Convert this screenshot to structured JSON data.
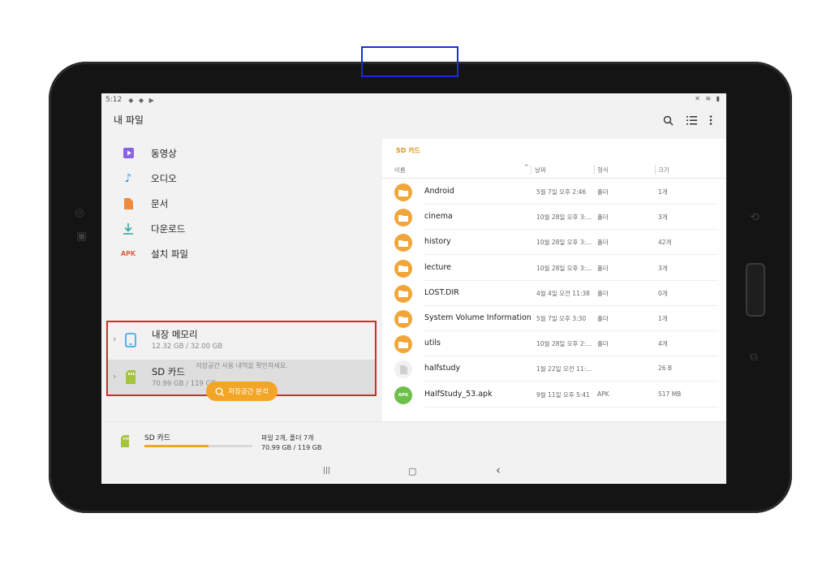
{
  "statusbar": {
    "time": "5:12",
    "left_icons": "◆ ◆ ▶",
    "right_icons": "✕ ≋ ▮"
  },
  "app": {
    "title": "내 파일"
  },
  "toolbar": {
    "search_icon": "search-icon",
    "list_icon": "list-view-icon",
    "more_icon": "more-vert-icon"
  },
  "categories": [
    {
      "label": "동영상",
      "icon": "video-icon",
      "color": "#8b63e0"
    },
    {
      "label": "오디오",
      "icon": "music-icon",
      "color": "#2e9ae6"
    },
    {
      "label": "문서",
      "icon": "document-icon",
      "color": "#f08a3c"
    },
    {
      "label": "다운로드",
      "icon": "download-icon",
      "color": "#38a7a0"
    },
    {
      "label": "설치 파일",
      "icon": "apk-icon",
      "text": "APK",
      "color": "#e25c3f"
    }
  ],
  "storage": [
    {
      "name": "내장 메모리",
      "size": "12.32 GB / 32.00 GB"
    },
    {
      "name": "SD 카드",
      "size": "70.99 GB / 119 GB"
    }
  ],
  "storage_hint": "저장공간 사용 내역을 확인하세요.",
  "analyze_button": "저장공간 분석",
  "path": "SD 카드",
  "columns": {
    "name": "이름",
    "date": "날짜",
    "type": "형식",
    "size": "크기"
  },
  "files": [
    {
      "name": "Android",
      "date": "5월 7일 오후 2:46",
      "type": "폴더",
      "size": "1개",
      "kind": "folder"
    },
    {
      "name": "cinema",
      "date": "10월 28일 오후 3:...",
      "type": "폴더",
      "size": "3개",
      "kind": "folder"
    },
    {
      "name": "history",
      "date": "10월 28일 오후 3:...",
      "type": "폴더",
      "size": "42개",
      "kind": "folder"
    },
    {
      "name": "lecture",
      "date": "10월 28일 오후 3:...",
      "type": "폴더",
      "size": "3개",
      "kind": "folder"
    },
    {
      "name": "LOST.DIR",
      "date": "4월 4일 오전 11:38",
      "type": "폴더",
      "size": "0개",
      "kind": "folder"
    },
    {
      "name": "System Volume Information",
      "date": "5월 7일 오후 3:30",
      "type": "폴더",
      "size": "1개",
      "kind": "folder"
    },
    {
      "name": "utils",
      "date": "10월 28일 오후 2:...",
      "type": "폴더",
      "size": "4개",
      "kind": "folder"
    },
    {
      "name": "halfstudy",
      "date": "1월 22일 오전 11:...",
      "type": "",
      "size": "26 B",
      "kind": "file"
    },
    {
      "name": "HalfStudy_53.apk",
      "date": "9월 11일 오후 5:41",
      "type": "APK",
      "size": "517 MB",
      "kind": "apk",
      "badge": "APK"
    }
  ],
  "bottom": {
    "name": "SD 카드",
    "counts": "파일 2개, 폴더 7개",
    "usage": "70.99 GB / 119 GB",
    "used_fraction": 0.5966
  },
  "navbar": {
    "recent": "|||",
    "home": "▢",
    "back": "‹"
  },
  "colors": {
    "accent": "#f3a525",
    "folder": "#f0a63a",
    "highlight_red": "#d42a2a",
    "highlight_blue": "#1a2fcf"
  }
}
